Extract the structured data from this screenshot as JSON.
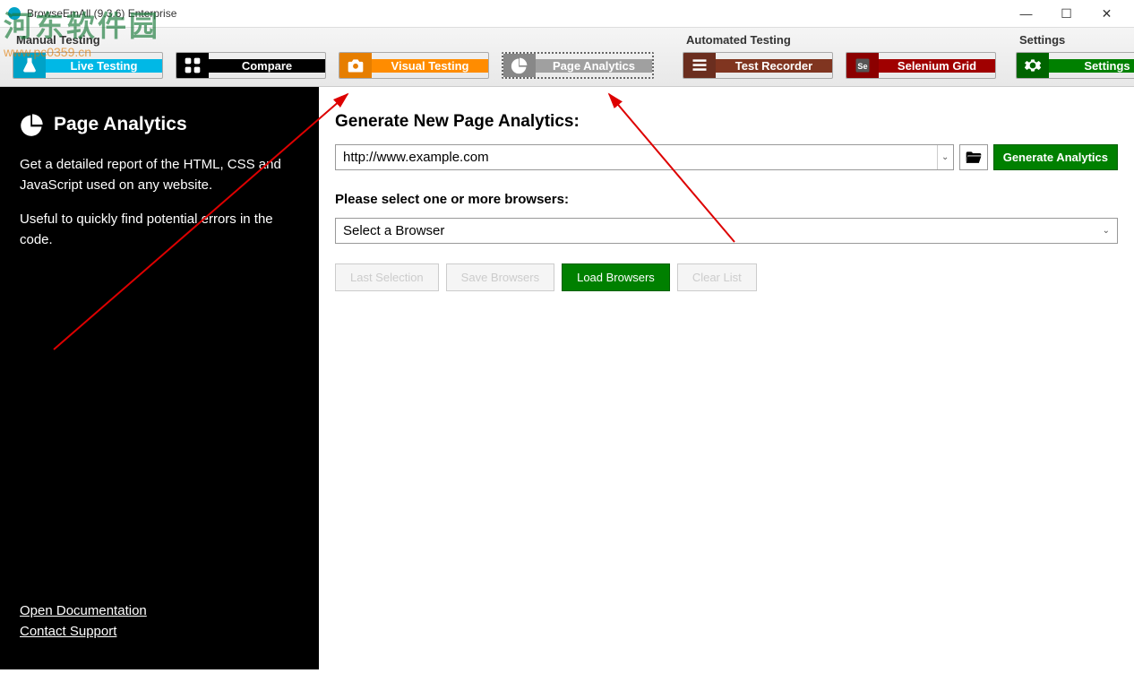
{
  "window": {
    "title": "BrowseEmAll (9.3.6) Enterprise"
  },
  "ribbon": {
    "manual": {
      "title": "Manual Testing",
      "live": "Live Testing",
      "compare": "Compare",
      "visual": "Visual Testing",
      "analytics": "Page Analytics"
    },
    "automated": {
      "title": "Automated Testing",
      "recorder": "Test Recorder",
      "selenium": "Selenium Grid"
    },
    "settings": {
      "title": "Settings",
      "settings": "Settings"
    }
  },
  "sidebar": {
    "title": "Page Analytics",
    "desc1": "Get a detailed report of the HTML, CSS and JavaScript used on any website.",
    "desc2": "Useful to quickly find potential errors in the code.",
    "open_doc": "Open Documentation",
    "contact": "Contact Support"
  },
  "content": {
    "heading": "Generate New Page Analytics:",
    "url_value": "http://www.example.com",
    "generate_btn": "Generate Analytics",
    "select_label": "Please select one or more browsers:",
    "select_placeholder": "Select a Browser",
    "last_selection": "Last Selection",
    "save_browsers": "Save Browsers",
    "load_browsers": "Load Browsers",
    "clear_list": "Clear List"
  },
  "watermark": {
    "text": "河东软件园",
    "sub": "www.pc0359.cn"
  }
}
